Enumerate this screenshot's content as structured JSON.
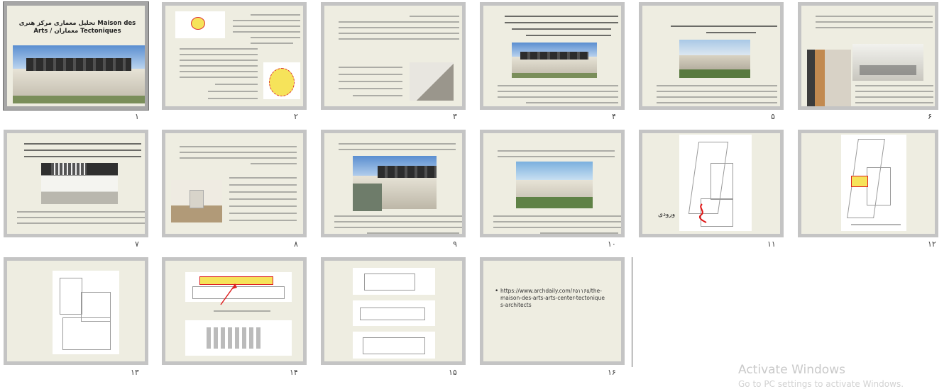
{
  "slides": [
    {
      "num": "١",
      "title": "تحلیل معماری مرکز هنری Maison des Arts / معماران Tectoniques",
      "selected": true
    },
    {
      "num": "۲"
    },
    {
      "num": "۳"
    },
    {
      "num": "۴"
    },
    {
      "num": "۵"
    },
    {
      "num": "۶"
    },
    {
      "num": "۷"
    },
    {
      "num": "۸"
    },
    {
      "num": "۹"
    },
    {
      "num": "۱۰"
    },
    {
      "num": "۱۱",
      "label": "ورودی"
    },
    {
      "num": "۱۲"
    },
    {
      "num": "۱۳"
    },
    {
      "num": "۱۴"
    },
    {
      "num": "۱۵"
    },
    {
      "num": "۱۶",
      "link": "https://www.archdaily.com/۶۵۱۱۶۵/the-maison-des-arts-arts-center-tectoniques-architects"
    }
  ],
  "watermark": {
    "line1": "Activate Windows",
    "line2": "Go to PC settings to activate Windows."
  }
}
